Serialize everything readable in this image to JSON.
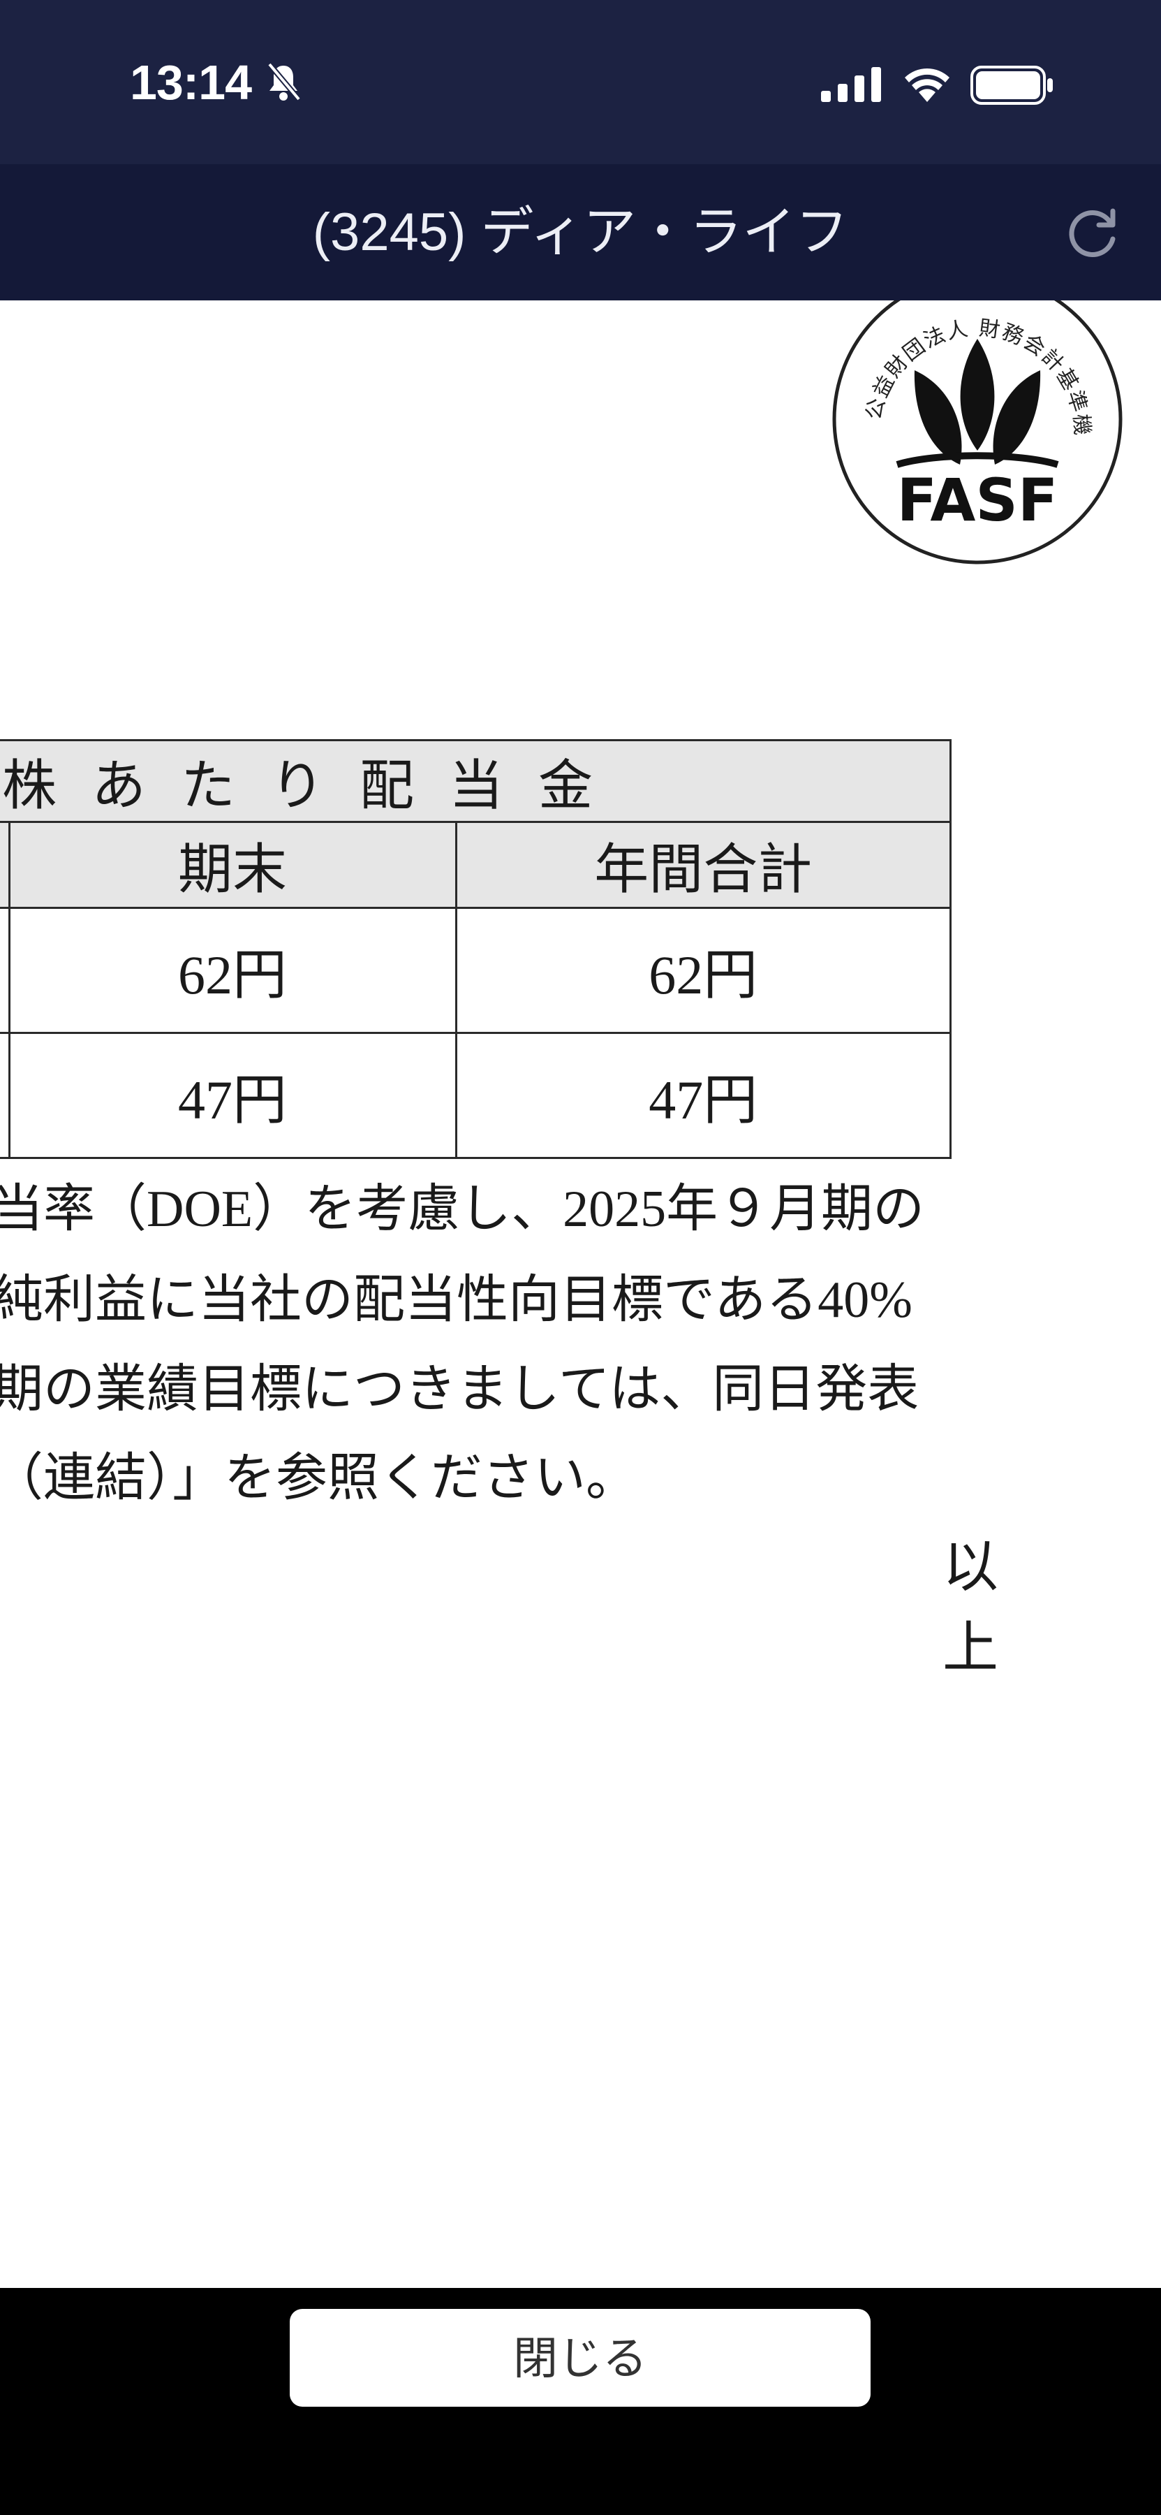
{
  "status_bar": {
    "time": "13:14",
    "icons": [
      "bell-slash-icon",
      "cellular-signal-icon",
      "wifi-icon",
      "battery-icon"
    ]
  },
  "header": {
    "title": "(3245) ディア・ライフ",
    "reload_icon": "reload-icon"
  },
  "seal": {
    "text_top": "公益財団法人 財務会計基準機構 会員",
    "logo_text": "FASF"
  },
  "table": {
    "title": "株あたり配当金",
    "col_headers": [
      "期末",
      "年間合計"
    ],
    "rows": [
      [
        "62円",
        "62円"
      ],
      [
        "47円",
        "47円"
      ]
    ]
  },
  "paragraph": {
    "lines": [
      "当率（DOE）を考慮し、2025年９月期の",
      "純利益に当社の配当性向目標である40%",
      "期の業績目標につきましては、同日発表",
      "（連結）」を参照ください。"
    ],
    "closing": "以上"
  },
  "footer": {
    "close_label": "閉じる"
  },
  "colors": {
    "status_bar_bg": "#1c2242",
    "title_bar_bg": "#141938",
    "table_header_bg": "#e6e6e6",
    "footer_bg": "#000000"
  }
}
